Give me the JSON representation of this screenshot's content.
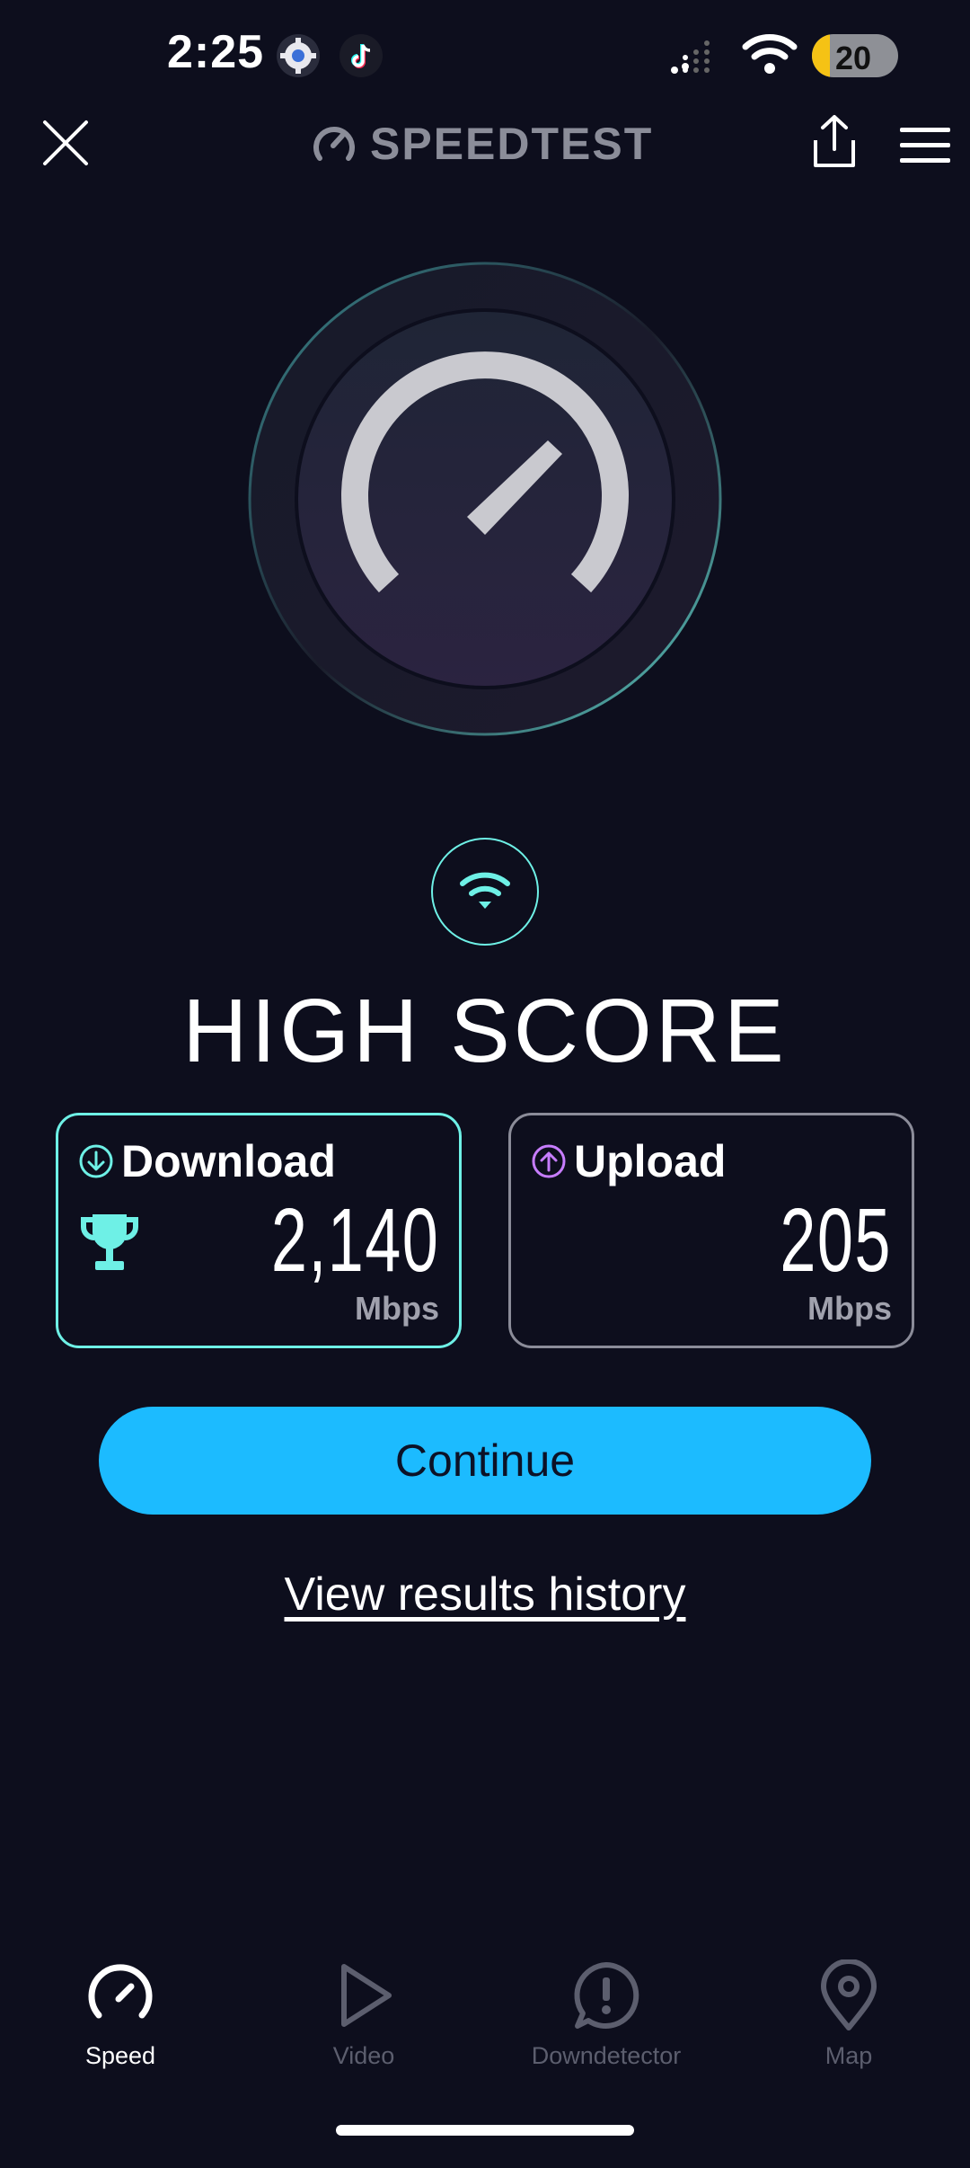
{
  "status_bar": {
    "time": "2:25",
    "battery": "20"
  },
  "header": {
    "title": "SPEEDTEST"
  },
  "result": {
    "heading": "HIGH SCORE",
    "download": {
      "label": "Download",
      "value": "2,140",
      "unit": "Mbps"
    },
    "upload": {
      "label": "Upload",
      "value": "205",
      "unit": "Mbps"
    }
  },
  "actions": {
    "continue_label": "Continue",
    "history_label": "View results history"
  },
  "bottom_nav": {
    "items": [
      {
        "label": "Speed",
        "icon": "gauge-icon",
        "active": true
      },
      {
        "label": "Video",
        "icon": "play-icon",
        "active": false
      },
      {
        "label": "Downdetector",
        "icon": "alert-icon",
        "active": false
      },
      {
        "label": "Map",
        "icon": "map-pin-icon",
        "active": false
      }
    ]
  },
  "colors": {
    "background": "#0d0e1d",
    "accent_cyan": "#6ef0e6",
    "continue_button": "#1cbbff",
    "upload_accent": "#c77dff",
    "battery_level": "#f5c215"
  }
}
